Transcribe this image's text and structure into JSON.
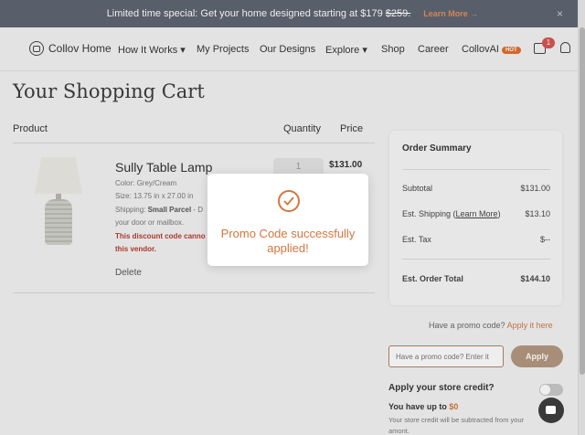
{
  "banner": {
    "text": "Limited time special: Get your home designed starting at $179",
    "old_price": "$259.",
    "cta": "Learn More →",
    "close": "×"
  },
  "nav": {
    "brand": "Collov Home",
    "items": [
      "How It Works ▾",
      "My Projects",
      "Our Designs",
      "Explore ▾",
      "Shop",
      "Career",
      "CollovAI"
    ],
    "hot_badge": "HOT",
    "cart_count": "1"
  },
  "page": {
    "title": "Your Shopping Cart"
  },
  "table": {
    "product": "Product",
    "quantity": "Quantity",
    "price": "Price"
  },
  "item": {
    "name": "Sully Table Lamp",
    "color": "Color: Grey/Cream",
    "size": "Size: 13.75 in x 27.00 in",
    "shipping_label": "Shipping:",
    "shipping_value": "Small Parcel",
    "shipping_rest": "- D",
    "shipping_line2": "your door or mailbox.",
    "warning1": "This discount code canno",
    "warning2": "this vendor.",
    "quantity": "1",
    "price": "$131.00",
    "delete": "Delete"
  },
  "summary": {
    "title": "Order Summary",
    "subtotal_label": "Subtotal",
    "subtotal": "$131.00",
    "shipping_label_pre": "Est. Shipping (",
    "shipping_link": "Learn More",
    "shipping_label_post": ")",
    "shipping": "$13.10",
    "tax_label": "Est. Tax",
    "tax": "$--",
    "total_label": "Est. Order Total",
    "total": "$144.10"
  },
  "promo": {
    "question": "Have a promo code?",
    "link": "Apply it here",
    "placeholder": "Have a promo code? Enter it",
    "apply": "Apply"
  },
  "credit": {
    "title": "Apply your store credit?",
    "amount_label": "You have up to",
    "amount": "$0",
    "note": "Your store credit will be subtracted from your amont."
  },
  "modal": {
    "message": "Promo Code successfully applied!"
  },
  "colors": {
    "accent": "#d3763f",
    "banner_bg": "#5d6470",
    "apply_btn": "#b4977f",
    "warning": "#b53a2d"
  },
  "icons": [
    "logo-icon",
    "cart-icon",
    "bell-icon",
    "check-icon",
    "chat-icon"
  ]
}
